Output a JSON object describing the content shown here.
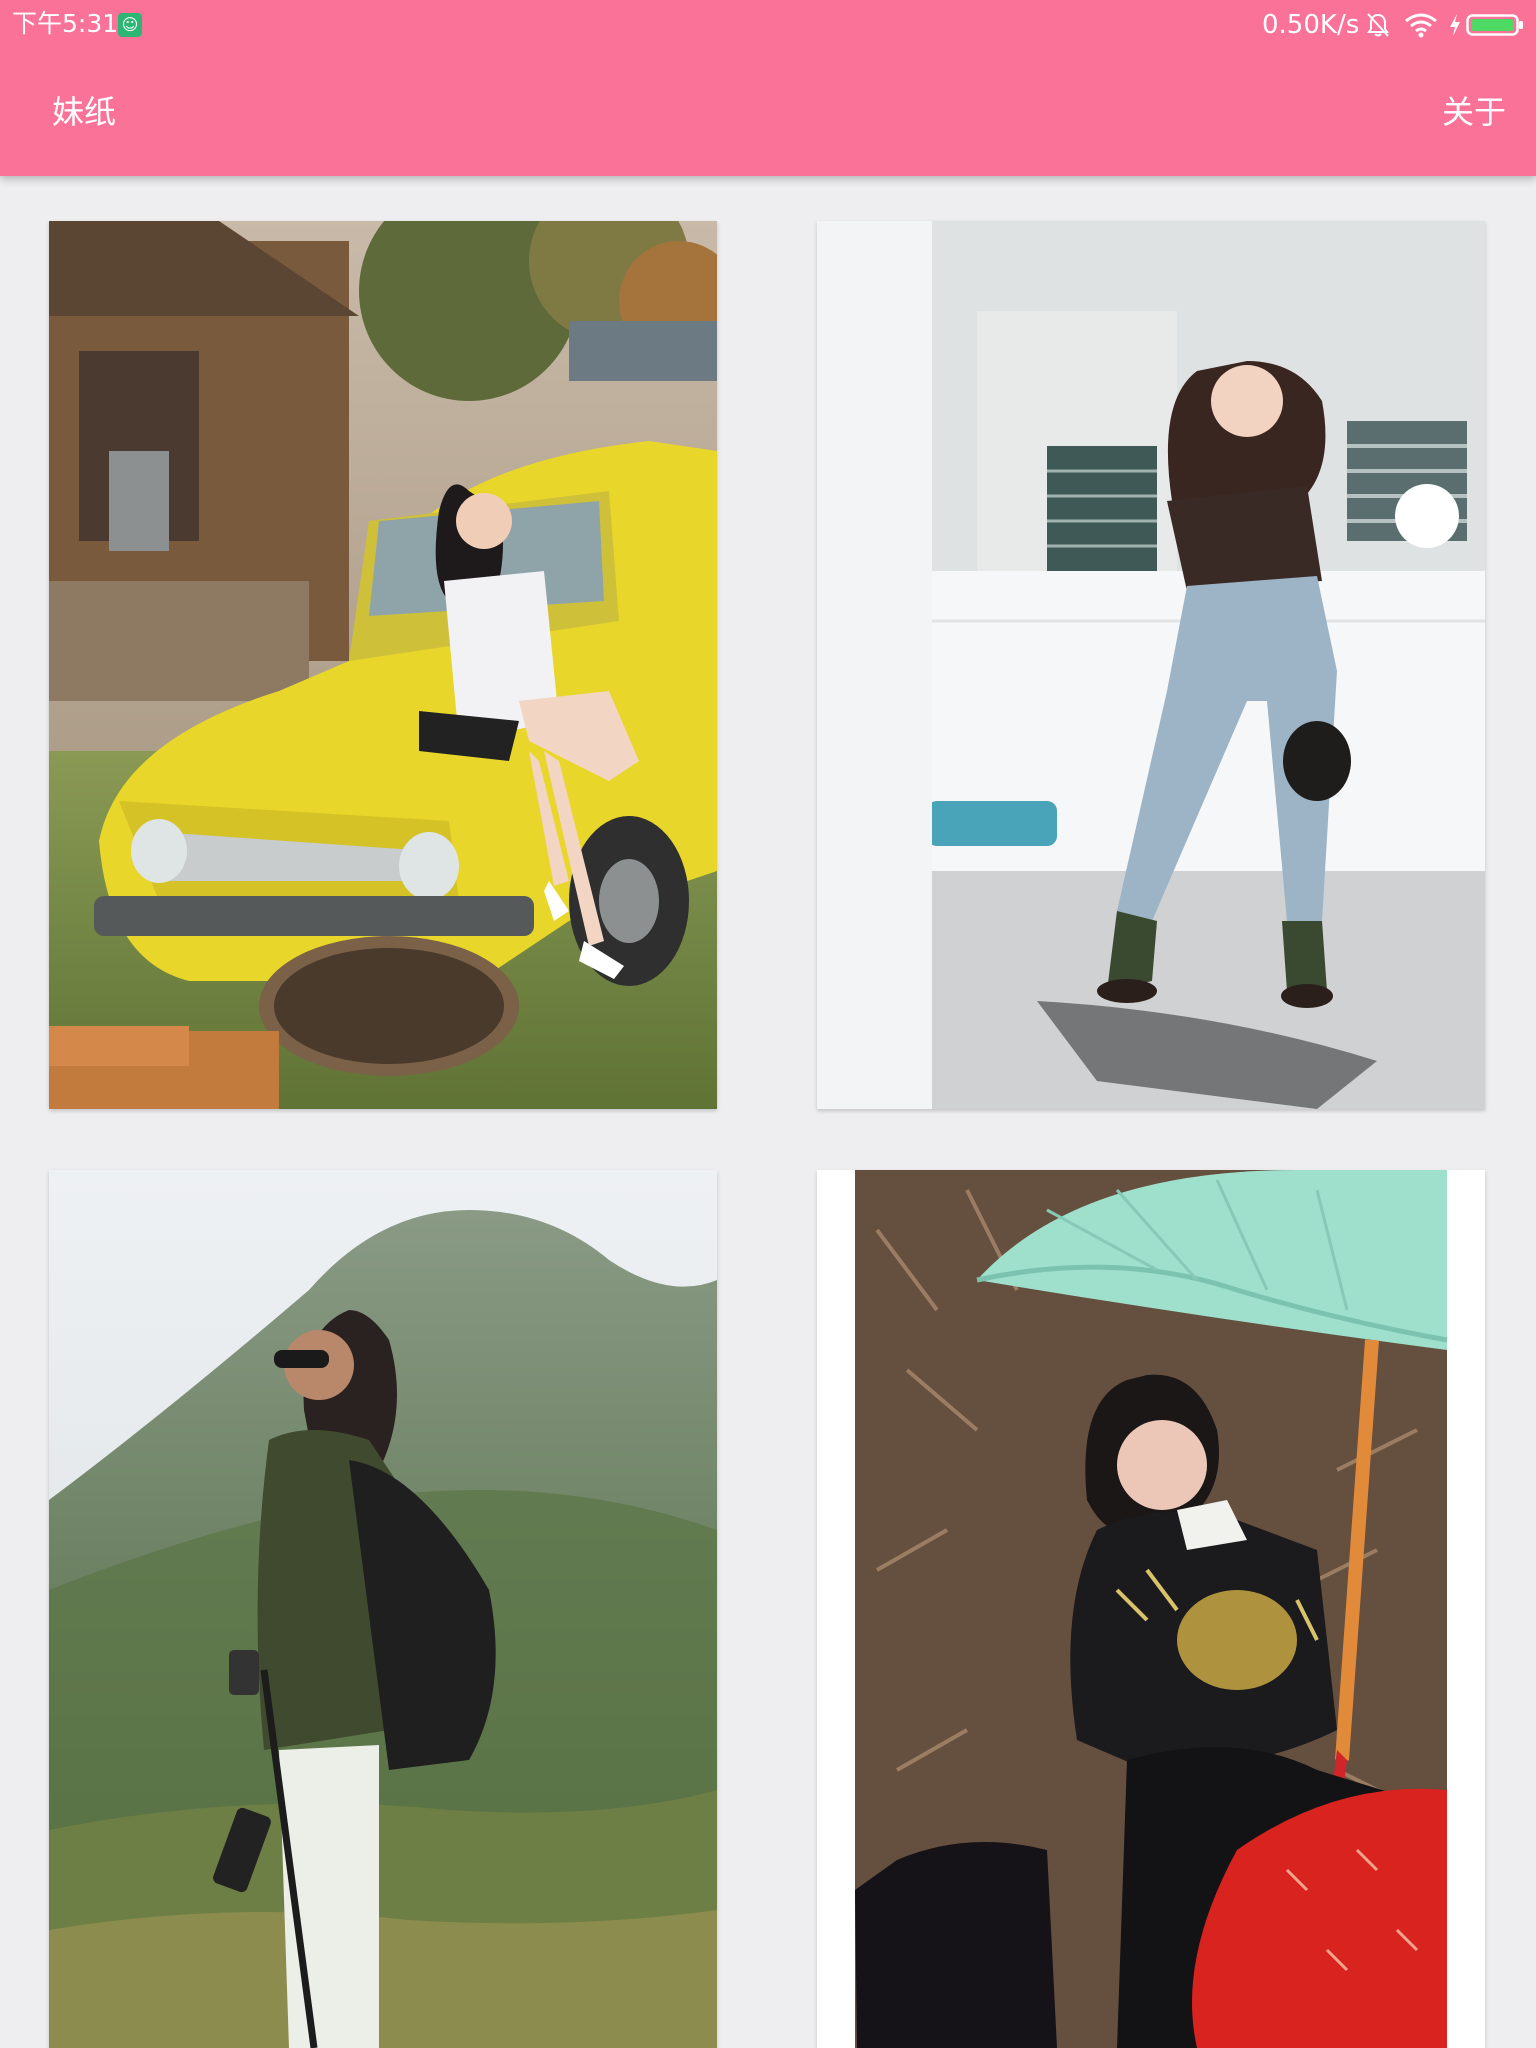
{
  "status_bar": {
    "time": "下午5:31",
    "network_speed": "0.50K/s",
    "icons": [
      "app-notification-icon",
      "mute-icon",
      "wifi-icon",
      "charging-bolt-icon",
      "battery-icon"
    ]
  },
  "toolbar": {
    "title": "妹纸",
    "action": "关于"
  },
  "colors": {
    "accent": "#fb7299",
    "background": "#eeeef0",
    "card": "#ffffff",
    "battery_fill": "#4cd964"
  },
  "gallery": {
    "items": [
      {
        "subject": "yellow-truck-photo"
      },
      {
        "subject": "rooftop-jeans-photo"
      },
      {
        "subject": "mountain-hiker-photo"
      },
      {
        "subject": "umbrella-hanfu-photo"
      }
    ]
  }
}
